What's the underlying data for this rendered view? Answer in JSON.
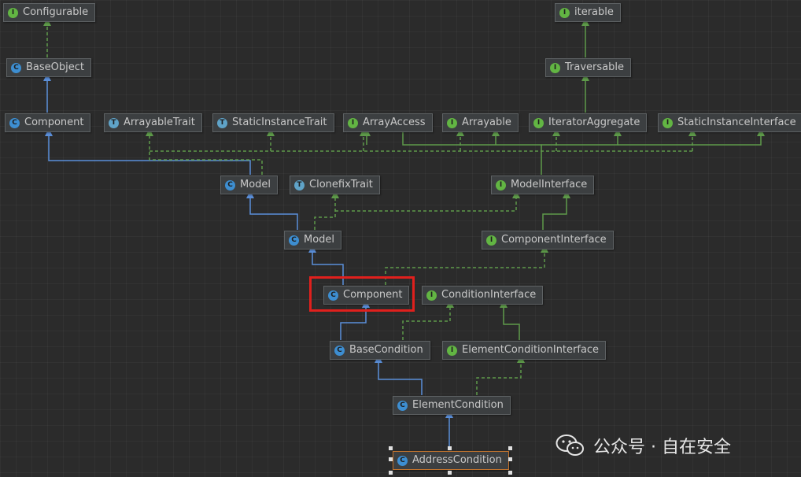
{
  "nodes": [
    {
      "id": "configurable",
      "label": "Configurable",
      "kind": "interface",
      "icon": "interface-icon"
    },
    {
      "id": "iterable",
      "label": "iterable",
      "kind": "interface",
      "icon": "interface-icon"
    },
    {
      "id": "baseobject",
      "label": "BaseObject",
      "kind": "class",
      "icon": "class-icon"
    },
    {
      "id": "traversable",
      "label": "Traversable",
      "kind": "interface",
      "icon": "interface-icon"
    },
    {
      "id": "component_top",
      "label": "Component",
      "kind": "class",
      "icon": "class-icon"
    },
    {
      "id": "arrayabletrait",
      "label": "ArrayableTrait",
      "kind": "trait",
      "icon": "trait-icon"
    },
    {
      "id": "staticinstancetrait",
      "label": "StaticInstanceTrait",
      "kind": "trait",
      "icon": "trait-icon"
    },
    {
      "id": "arrayaccess",
      "label": "ArrayAccess",
      "kind": "interface",
      "icon": "interface-icon"
    },
    {
      "id": "arrayable",
      "label": "Arrayable",
      "kind": "interface",
      "icon": "interface-icon"
    },
    {
      "id": "iteratoraggregate",
      "label": "IteratorAggregate",
      "kind": "interface",
      "icon": "interface-icon"
    },
    {
      "id": "staticinstanceinterface",
      "label": "StaticInstanceInterface",
      "kind": "interface",
      "icon": "interface-icon"
    },
    {
      "id": "model_base",
      "label": "Model",
      "kind": "class",
      "icon": "class-icon"
    },
    {
      "id": "clonefixtrait",
      "label": "ClonefixTrait",
      "kind": "trait",
      "icon": "trait-icon"
    },
    {
      "id": "modelinterface",
      "label": "ModelInterface",
      "kind": "interface",
      "icon": "interface-icon"
    },
    {
      "id": "model_abs",
      "label": "Model",
      "kind": "abstract",
      "icon": "abstract-class-icon"
    },
    {
      "id": "componentinterface",
      "label": "ComponentInterface",
      "kind": "interface",
      "icon": "interface-icon"
    },
    {
      "id": "component_abs",
      "label": "Component",
      "kind": "abstract",
      "icon": "abstract-class-icon"
    },
    {
      "id": "conditioninterface",
      "label": "ConditionInterface",
      "kind": "interface",
      "icon": "interface-icon"
    },
    {
      "id": "basecondition",
      "label": "BaseCondition",
      "kind": "abstract",
      "icon": "abstract-class-icon"
    },
    {
      "id": "elementconditioninterface",
      "label": "ElementConditionInterface",
      "kind": "interface",
      "icon": "interface-icon"
    },
    {
      "id": "elementcondition",
      "label": "ElementCondition",
      "kind": "class",
      "icon": "class-icon"
    },
    {
      "id": "addresscondition",
      "label": "AddressCondition",
      "kind": "class",
      "icon": "class-icon",
      "selected": true
    }
  ],
  "badge_letters": {
    "class": "C",
    "interface": "I",
    "trait": "T",
    "abstract": "C"
  },
  "colors": {
    "extends_edge": "#5b8fd9",
    "implements_edge": "#5e9a4a",
    "highlight": "#e0201d",
    "selection": "#c2732d"
  },
  "highlighted_node": "component_abs",
  "watermark": {
    "text": "公众号 · 自在安全",
    "icon": "wechat-icon"
  }
}
